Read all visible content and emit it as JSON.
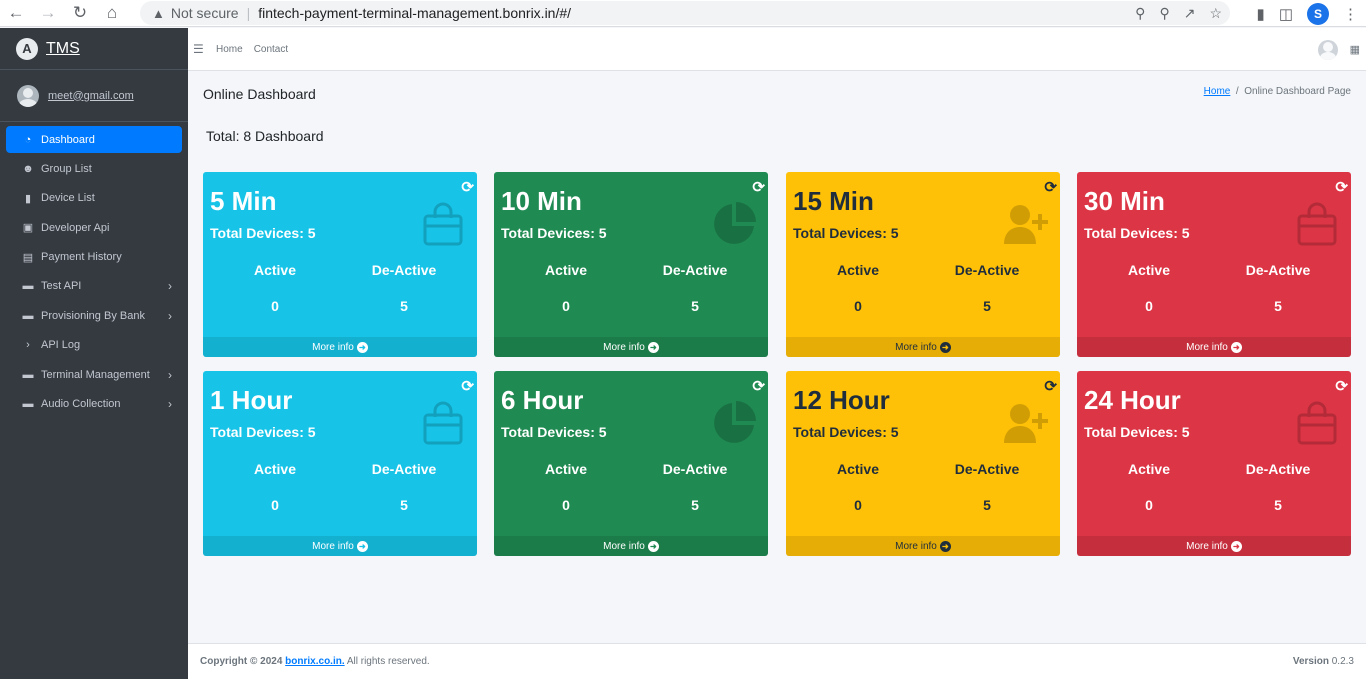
{
  "browser": {
    "not_secure": "Not secure",
    "url": "fintech-payment-terminal-management.bonrix.in/#/",
    "profile_initial": "S"
  },
  "sidebar": {
    "brand": "TMS",
    "brand_logo": "A",
    "user_email": "meet@gmail.com",
    "items": [
      {
        "label": "Dashboard",
        "icon": "dashboard-icon",
        "glyph": "◔",
        "arrow": ""
      },
      {
        "label": "Group List",
        "icon": "users-icon",
        "glyph": "☻",
        "arrow": ""
      },
      {
        "label": "Device List",
        "icon": "mobile-icon",
        "glyph": "▮",
        "arrow": ""
      },
      {
        "label": "Developer Api",
        "icon": "box-icon",
        "glyph": "▣",
        "arrow": ""
      },
      {
        "label": "Payment History",
        "icon": "table-icon",
        "glyph": "▤",
        "arrow": ""
      },
      {
        "label": "Test API",
        "icon": "folder-icon",
        "glyph": "▬",
        "arrow": "›"
      },
      {
        "label": "Provisioning By Bank",
        "icon": "folder-icon",
        "glyph": "▬",
        "arrow": "›"
      },
      {
        "label": "API Log",
        "icon": "chevron-right-icon",
        "glyph": "›",
        "arrow": ""
      },
      {
        "label": "Terminal Management",
        "icon": "folder-icon",
        "glyph": "▬",
        "arrow": "›"
      },
      {
        "label": "Audio Collection",
        "icon": "folder-icon",
        "glyph": "▬",
        "arrow": "›"
      }
    ]
  },
  "navbar": {
    "home": "Home",
    "contact": "Contact"
  },
  "content": {
    "title": "Online Dashboard",
    "breadcrumb_home": "Home",
    "breadcrumb_sep": "/",
    "breadcrumb_current": "Online Dashboard Page",
    "total": "Total: 8 Dashboard"
  },
  "cards": [
    {
      "title": "5 Min",
      "devices": "Total Devices: 5",
      "active_label": "Active",
      "deactive_label": "De-Active",
      "active": "0",
      "deactive": "5",
      "footer": "More info",
      "icon": "shopping-bag-icon",
      "color": "#17c4e8"
    },
    {
      "title": "10 Min",
      "devices": "Total Devices: 5",
      "active_label": "Active",
      "deactive_label": "De-Active",
      "active": "0",
      "deactive": "5",
      "footer": "More info",
      "icon": "pie-chart-icon",
      "color": "#1f8a52"
    },
    {
      "title": "15 Min",
      "devices": "Total Devices: 5",
      "active_label": "Active",
      "deactive_label": "De-Active",
      "active": "0",
      "deactive": "5",
      "footer": "More info",
      "icon": "user-plus-icon",
      "color": "#ffc107"
    },
    {
      "title": "30 Min",
      "devices": "Total Devices: 5",
      "active_label": "Active",
      "deactive_label": "De-Active",
      "active": "0",
      "deactive": "5",
      "footer": "More info",
      "icon": "shopping-bag-icon",
      "color": "#dc3545"
    },
    {
      "title": "1 Hour",
      "devices": "Total Devices: 5",
      "active_label": "Active",
      "deactive_label": "De-Active",
      "active": "0",
      "deactive": "5",
      "footer": "More info",
      "icon": "shopping-bag-icon",
      "color": "#17c4e8"
    },
    {
      "title": "6 Hour",
      "devices": "Total Devices: 5",
      "active_label": "Active",
      "deactive_label": "De-Active",
      "active": "0",
      "deactive": "5",
      "footer": "More info",
      "icon": "pie-chart-icon",
      "color": "#1f8a52"
    },
    {
      "title": "12 Hour",
      "devices": "Total Devices: 5",
      "active_label": "Active",
      "deactive_label": "De-Active",
      "active": "0",
      "deactive": "5",
      "footer": "More info",
      "icon": "user-plus-icon",
      "color": "#ffc107"
    },
    {
      "title": "24 Hour",
      "devices": "Total Devices: 5",
      "active_label": "Active",
      "deactive_label": "De-Active",
      "active": "0",
      "deactive": "5",
      "footer": "More info",
      "icon": "shopping-bag-icon",
      "color": "#dc3545"
    }
  ],
  "footer": {
    "copyright": "Copyright © 2024",
    "link": "bonrix.co.in.",
    "rights": "All rights reserved.",
    "version_label": "Version",
    "version": "0.2.3"
  }
}
